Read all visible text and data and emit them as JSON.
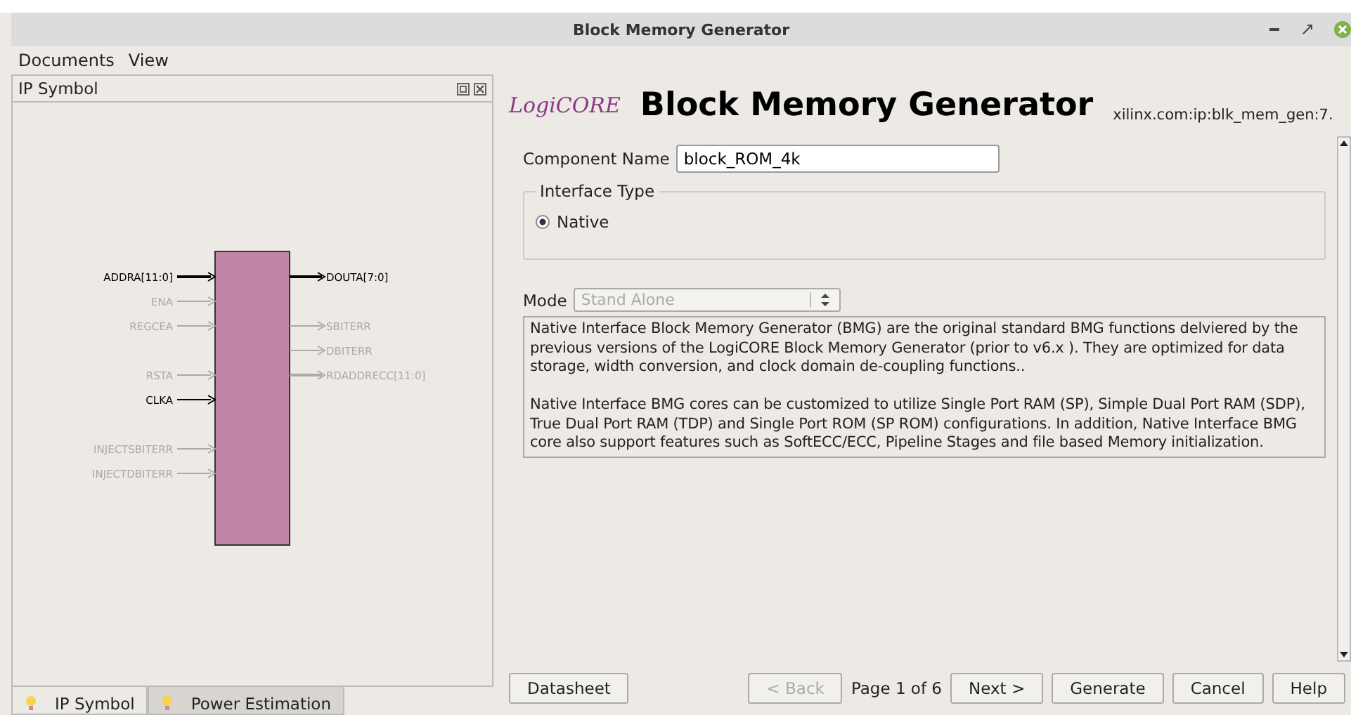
{
  "window": {
    "title": "Block Memory Generator"
  },
  "menu": [
    {
      "label": "Documents"
    },
    {
      "label": "View"
    }
  ],
  "left_panel": {
    "title": "IP Symbol",
    "input_pins": [
      {
        "label": "ADDRA[11:0]",
        "enabled": true,
        "bus": true
      },
      {
        "label": "ENA",
        "enabled": false,
        "bus": false
      },
      {
        "label": "REGCEA",
        "enabled": false,
        "bus": false
      },
      {
        "label": "RSTA",
        "enabled": false,
        "bus": false
      },
      {
        "label": "CLKA",
        "enabled": true,
        "bus": false
      },
      {
        "label": "INJECTSBITERR",
        "enabled": false,
        "bus": false
      },
      {
        "label": "INJECTDBITERR",
        "enabled": false,
        "bus": false
      }
    ],
    "output_pins": [
      {
        "label": "DOUTA[7:0]",
        "enabled": true,
        "bus": true
      },
      {
        "label": "SBITERR",
        "enabled": false,
        "bus": false
      },
      {
        "label": "DBITERR",
        "enabled": false,
        "bus": false
      },
      {
        "label": "RDADDRECC[11:0]",
        "enabled": false,
        "bus": true
      }
    ],
    "tabs": [
      {
        "label": "IP Symbol",
        "selected": true
      },
      {
        "label": "Power Estimation",
        "selected": false
      }
    ]
  },
  "header": {
    "logo": "LogiCORE",
    "title": "Block Memory Generator",
    "vlnv": "xilinx.com:ip:blk_mem_gen:7."
  },
  "component_name": {
    "label": "Component Name",
    "value": "block_ROM_4k"
  },
  "interface_type": {
    "legend": "Interface Type",
    "options": [
      {
        "label": "Native",
        "selected": true
      }
    ]
  },
  "mode": {
    "label": "Mode",
    "value": "Stand Alone",
    "disabled": true
  },
  "description": [
    "Native Interface Block Memory Generator (BMG) are the original standard BMG functions delviered by the previous versions of the  LogiCORE Block Memory Generator (prior to v6.x ). They are optimized for data storage, width conversion, and clock domain de-coupling functions..",
    "Native  Interface BMG cores can be customized to utilize Single Port RAM (SP), Simple Dual Port RAM (SDP), True Dual Port RAM (TDP) and Single Port ROM (SP ROM)  configurations. In addition, Native Interface BMG core also support features such as SoftECC/ECC, Pipeline Stages and file based Memory initialization."
  ],
  "datasheet_button": {
    "label": "Datasheet"
  },
  "nav": {
    "back": {
      "label": "< Back",
      "disabled": true
    },
    "page": "Page 1 of 6",
    "buttons": [
      {
        "label": "Next >",
        "disabled": false
      },
      {
        "label": "Generate",
        "disabled": false
      },
      {
        "label": "Cancel",
        "disabled": false
      },
      {
        "label": "Help",
        "disabled": false
      }
    ]
  }
}
